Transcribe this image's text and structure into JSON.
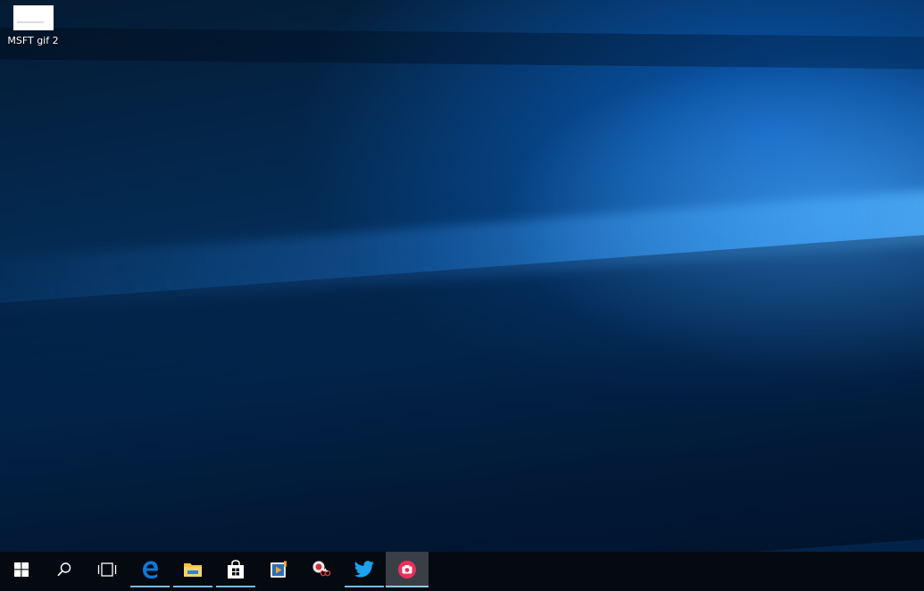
{
  "desktop": {
    "icons": [
      {
        "label": "MSFT gif 2",
        "icon": "image-file-icon"
      }
    ]
  },
  "taskbar": {
    "items": [
      {
        "name": "start",
        "icon": "windows-logo-icon"
      },
      {
        "name": "search",
        "icon": "search-icon"
      },
      {
        "name": "task-view",
        "icon": "task-view-icon"
      },
      {
        "name": "edge",
        "icon": "edge-icon",
        "running": true
      },
      {
        "name": "file-explorer",
        "icon": "folder-icon",
        "running": true
      },
      {
        "name": "store",
        "icon": "store-icon",
        "running": true
      },
      {
        "name": "media-player",
        "icon": "media-player-icon"
      },
      {
        "name": "snipping-tool",
        "icon": "snipping-tool-icon"
      },
      {
        "name": "twitter",
        "icon": "twitter-icon",
        "running": true
      },
      {
        "name": "camera",
        "icon": "camera-icon",
        "active": true
      }
    ]
  },
  "colors": {
    "accent": "#76b9ed",
    "taskbar": "#050a10",
    "edge": "#0f78d7",
    "folder": "#f6c244",
    "twitter": "#1da1f2",
    "camera": "#e9305b"
  }
}
